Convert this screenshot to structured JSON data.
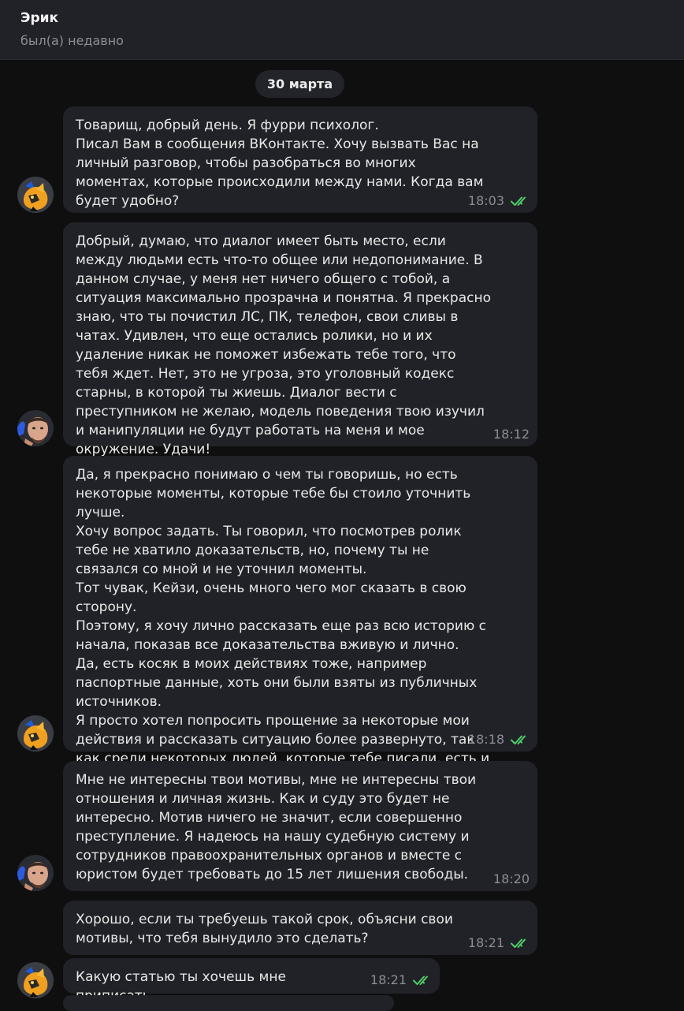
{
  "header": {
    "name": "Эрик",
    "status": "был(а) недавно"
  },
  "date_separator": "30 марта",
  "messages": [
    {
      "text": "Товарищ, добрый день. Я фурри психолог.\nПисал Вам в сообщения ВКонтакте. Хочу вызвать Вас на личный разговор, чтобы разобраться во многих моментах, которые происходили между нами. Когда вам будет удобно?",
      "time": "18:03"
    },
    {
      "text": "Добрый, думаю, что диалог имеет быть место, если между людьми есть что-то общее или недопонимание. В данном случае, у меня нет ничего общего с тобой, а ситуация максимально прозрачна и понятна. Я прекрасно знаю, что ты почистил ЛС, ПК, телефон, свои сливы в чатах. Удивлен, что еще остались ролики, но и их удаление никак не поможет избежать тебе того, что тебя ждет. Нет, это не угроза, это уголовный кодекс старны, в которой ты жиешь. Диалог вести с преступником не желаю, модель поведения твою изучил и манипуляции не будут работать на меня и мое окружение. Удачи!",
      "time": "18:12"
    },
    {
      "text": "Да, я прекрасно понимаю о чем ты говоришь, но есть некоторые моменты, которые тебе бы стоило уточнить лучше.\nХочу вопрос задать. Ты говорил, что посмотрев ролик тебе не хватило доказательств, но, почему ты не связался со мной и не уточнил моменты.\nТот чувак, Кейзи, очень много чего мог сказать в свою сторону.\nПоэтому, я хочу лично рассказать еще раз всю историю с начала, показав все доказательства вживую и лично.\nДа, есть косяк в моих действиях тоже, например паспортные данные, хоть они были взяты из публичных источников.\nЯ просто хотел попросить прощение за некоторые мои действия и рассказать ситуацию более развернуто, так как среди некоторых людей, которые тебе писали, есть и обманщики, которые пользуясь \"случаем\" могут наговорить всякой ерунды",
      "time": "18:18"
    },
    {
      "text": "Мне не интересны твои мотивы, мне не интересны твои отношения и личная жизнь. Как и суду это будет не интересно. Мотив ничего не значит, если совершенно преступление. Я надеюсь на нашу судебную систему и сотрудников правоохранительных органов и вместе с юристом будет требовать до 15 лет лишения свободы.",
      "time": "18:20"
    },
    {
      "text": "Хорошо, если ты требуешь такой срок, объясни свои мотивы, что тебя вынудило это сделать?",
      "time": "18:21"
    },
    {
      "text": "Какую статью ты хочешь мне приписать",
      "time": "18:21"
    }
  ],
  "colors": {
    "check": "#4fcf6a",
    "bubble": "#212227",
    "background": "#0f0f10"
  }
}
